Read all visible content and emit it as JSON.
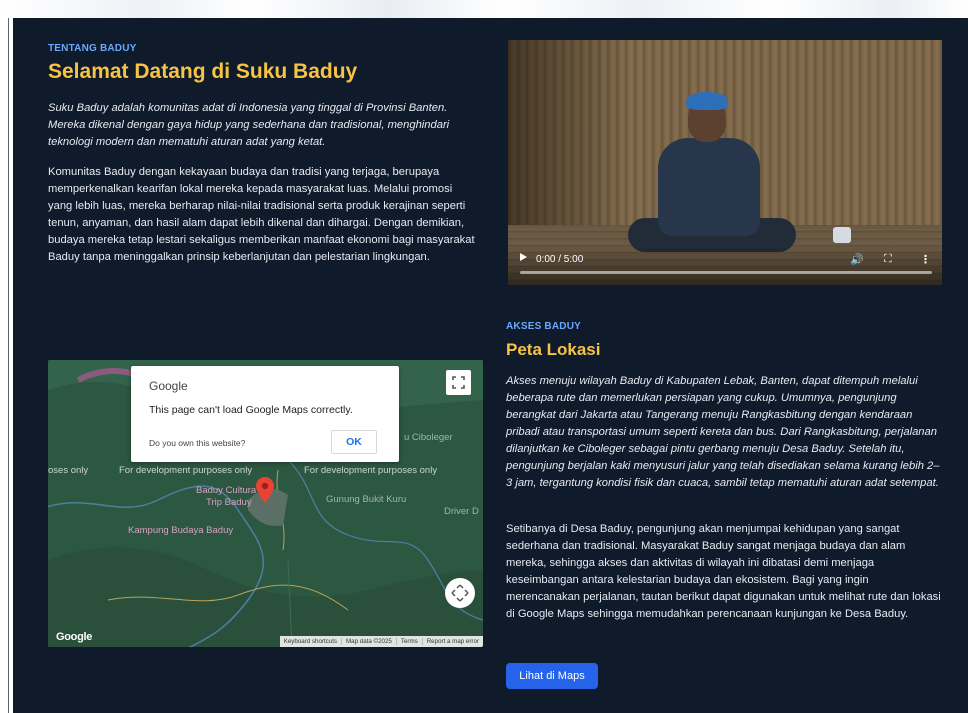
{
  "about": {
    "eyebrow": "TENTANG BADUY",
    "title": "Selamat Datang di Suku Baduy",
    "intro": "Suku Baduy adalah komunitas adat di Indonesia yang tinggal di Provinsi Banten. Mereka dikenal dengan gaya hidup yang sederhana dan tradisional, menghindari teknologi modern dan mematuhi aturan adat yang ketat.",
    "body": "Komunitas Baduy dengan kekayaan budaya dan tradisi yang terjaga, berupaya memperkenalkan kearifan lokal mereka kepada masyarakat luas. Melalui promosi yang lebih luas, mereka berharap nilai-nilai tradisional serta produk kerajinan seperti tenun, anyaman, dan hasil alam dapat lebih dikenal dan dihargai. Dengan demikian, budaya mereka tetap lestari sekaligus memberikan manfaat ekonomi bagi masyarakat Baduy tanpa meninggalkan prinsip keberlanjutan dan pelestarian lingkungan."
  },
  "video": {
    "time": "0:00 / 5:00",
    "progress": 0
  },
  "access": {
    "eyebrow": "AKSES BADUY",
    "title": "Peta Lokasi",
    "intro": "Akses menuju wilayah Baduy di Kabupaten Lebak, Banten, dapat ditempuh melalui beberapa rute dan memerlukan persiapan yang cukup. Umumnya, pengunjung berangkat dari Jakarta atau Tangerang menuju Rangkasbitung dengan kendaraan pribadi atau transportasi umum seperti kereta dan bus. Dari Rangkasbitung, perjalanan dilanjutkan ke Ciboleger sebagai pintu gerbang menuju Desa Baduy. Setelah itu, pengunjung berjalan kaki menyusuri jalur yang telah disediakan selama kurang lebih 2–3 jam, tergantung kondisi fisik dan cuaca, sambil tetap mematuhi aturan adat setempat.",
    "body": "Setibanya di Desa Baduy, pengunjung akan menjumpai kehidupan yang sangat sederhana dan tradisional. Masyarakat Baduy sangat menjaga budaya dan alam mereka, sehingga akses dan aktivitas di wilayah ini dibatasi demi menjaga keseimbangan antara kelestarian budaya dan ekosistem. Bagi yang ingin merencanakan perjalanan, tautan berikut dapat digunakan untuk melihat rute dan lokasi di Google Maps sehingga memudahkan perencanaan kunjungan ke Desa Baduy.",
    "button": "Lihat di Maps"
  },
  "map": {
    "dialog_brand": "Google",
    "dialog_message": "This page can't load Google Maps correctly.",
    "dialog_question": "Do you own this website?",
    "dialog_ok": "OK",
    "watermark_left_edge": "oses only",
    "watermark_1": "For development purposes only",
    "watermark_2": "For development purposes only",
    "place_ciboleger": "u Ciboleger",
    "place_culture_1": "Baduy Cultura",
    "place_culture_2": "Trip Baduy",
    "place_bukit": "Gunung Bukit Kuru",
    "place_driver": "Driver D",
    "place_kampung": "Kampung Budaya Baduy",
    "logo": "Google",
    "footer": [
      "Keyboard shortcuts",
      "Map data ©2025",
      "Terms",
      "Report a map error"
    ]
  },
  "colors": {
    "background": "#0f1a2b",
    "accent_heading": "#f6c344",
    "eyebrow": "#6aa8ff",
    "button": "#2563eb"
  }
}
